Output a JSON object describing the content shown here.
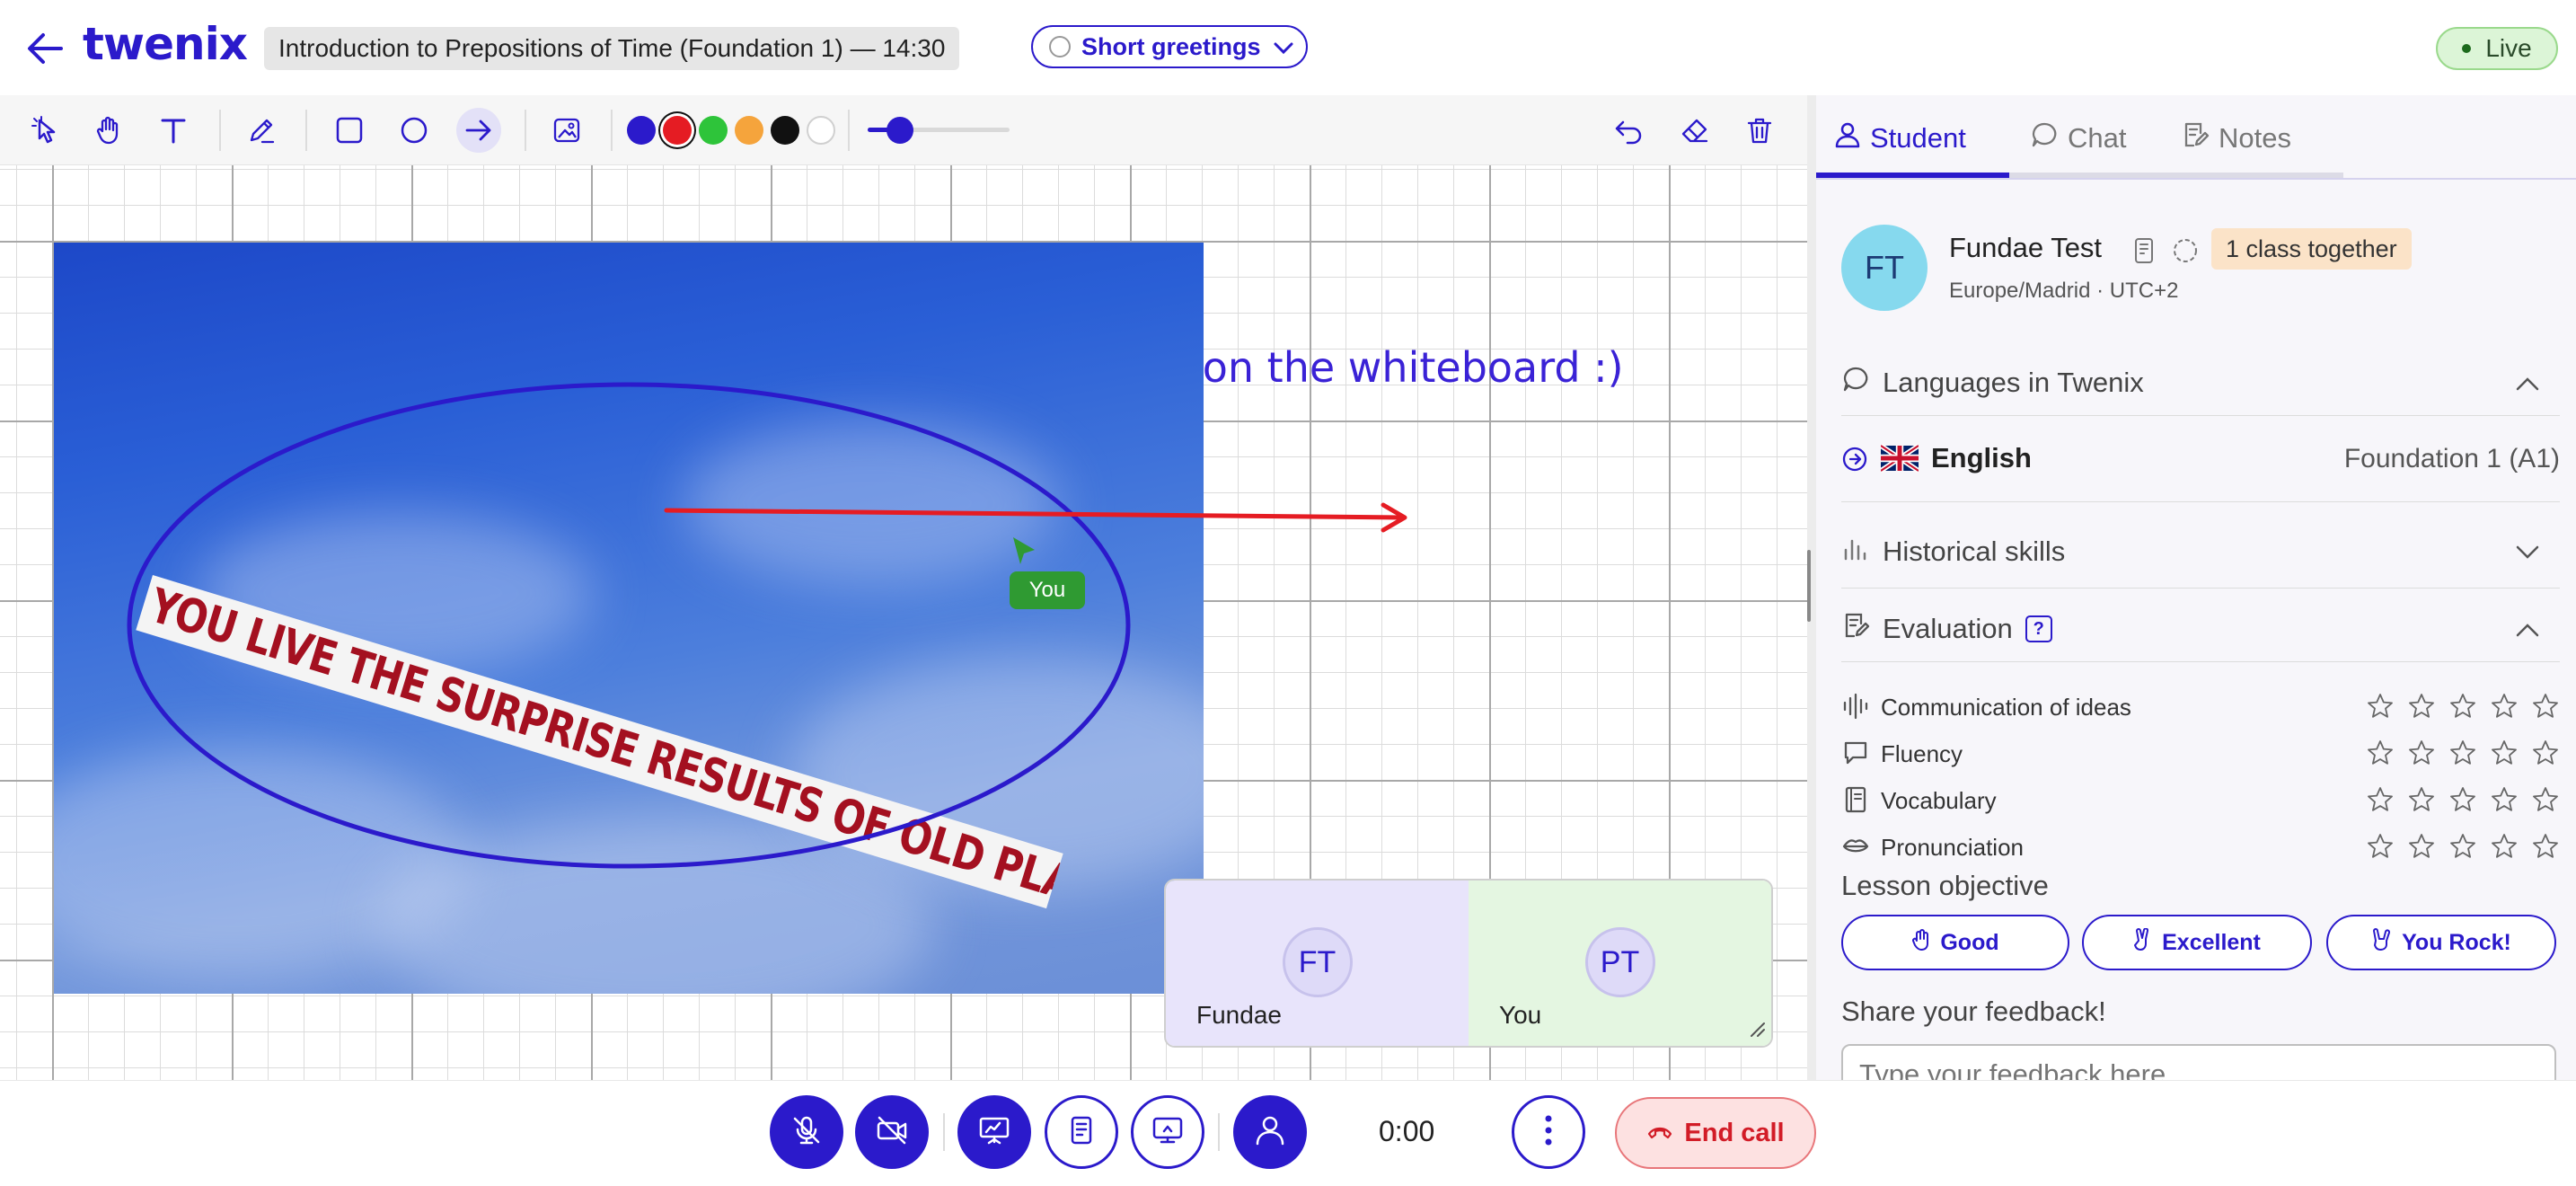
{
  "header": {
    "logo": "twenix",
    "lesson_title": "Introduction to Prepositions of Time (Foundation 1) — 14:30",
    "activity": "Short greetings",
    "live": "Live"
  },
  "toolbar": {
    "tools": [
      "select-icon",
      "hand-icon",
      "text-icon",
      "pencil-icon",
      "rectangle-icon",
      "circle-icon",
      "arrow-icon",
      "image-icon"
    ],
    "active_tool": "arrow-icon",
    "colors": [
      "#2b1acb",
      "#e51c23",
      "#2ec43a",
      "#f5a43c",
      "#111111",
      "#ffffff"
    ],
    "selected_color": "#e51c23",
    "stroke_level": 0.23,
    "right_tools": [
      "undo-icon",
      "eraser-icon",
      "trash-icon"
    ]
  },
  "whiteboard": {
    "text": "o on the whiteboard :)",
    "banner_text": "YOU LIVE THE SURPRISE RESULTS OF OLD PLANS",
    "cursor_label": "You",
    "ink_colors": {
      "ellipse": "#2b1acb",
      "arrow": "#e51c23",
      "cursor": "#2f9a32"
    }
  },
  "video": {
    "tiles": [
      {
        "initials": "FT",
        "name": "Fundae"
      },
      {
        "initials": "PT",
        "name": "You"
      }
    ]
  },
  "panel": {
    "tabs": [
      {
        "label": "Student",
        "icon": "person-icon",
        "active": true
      },
      {
        "label": "Chat",
        "icon": "chat-icon",
        "active": false
      },
      {
        "label": "Notes",
        "icon": "notes-icon",
        "active": false
      }
    ],
    "student": {
      "initials": "FT",
      "name": "Fundae Test",
      "badge": "1 class together",
      "timezone": "Europe/Madrid · UTC+2"
    },
    "languages": {
      "title": "Languages in Twenix",
      "items": [
        {
          "name": "English",
          "level": "Foundation 1 (A1)"
        }
      ]
    },
    "historical": {
      "title": "Historical skills"
    },
    "evaluation": {
      "title": "Evaluation",
      "help": "?",
      "criteria": [
        {
          "label": "Communication of ideas",
          "icon": "waveform-icon",
          "rating": 0
        },
        {
          "label": "Fluency",
          "icon": "speech-bubble-icon",
          "rating": 0
        },
        {
          "label": "Vocabulary",
          "icon": "book-icon",
          "rating": 0
        },
        {
          "label": "Pronunciation",
          "icon": "lips-icon",
          "rating": 0
        }
      ],
      "max_rating": 5
    },
    "objective": {
      "title": "Lesson objective",
      "buttons": [
        "Good",
        "Excellent",
        "You Rock!"
      ]
    },
    "feedback": {
      "title": "Share your feedback!",
      "placeholder": "Type your feedback here"
    }
  },
  "controls": {
    "timer": "0:00",
    "end_call": "End call"
  }
}
